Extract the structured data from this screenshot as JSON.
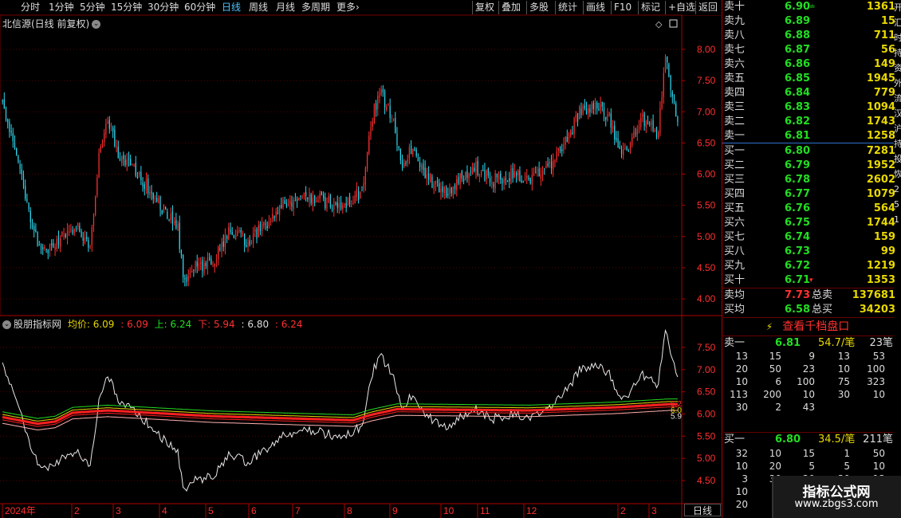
{
  "toolbar": {
    "periods": [
      "分时",
      "1分钟",
      "5分钟",
      "15分钟",
      "30分钟",
      "60分钟",
      "日线",
      "周线",
      "月线",
      "多周期",
      "更多"
    ],
    "active_period": "日线",
    "more_suffix": "›",
    "buttons": [
      "复权",
      "叠加",
      "多股",
      "统计",
      "画线",
      "F10",
      "标记",
      "+自选",
      "返回"
    ]
  },
  "main_chart": {
    "title": "北信源(日线 前复权)",
    "y_ticks": [
      "8.00",
      "7.50",
      "7.00",
      "6.50",
      "6.00",
      "5.50",
      "5.00",
      "4.50",
      "4.00"
    ],
    "y_values": [
      8.0,
      7.5,
      7.0,
      6.5,
      6.0,
      5.5,
      5.0,
      4.5,
      4.0
    ]
  },
  "indicator": {
    "name": "股朋指标网",
    "avg_label": "均价:",
    "avg_value": "6.09",
    "v2": ": 6.09",
    "up_label": "上:",
    "up_value": "6.24",
    "down_label": "下:",
    "down_value": "5.94",
    "v5": ": 6.80",
    "v6": ": 6.24",
    "y_ticks": [
      "7.50",
      "7.00",
      "6.50",
      "6.00",
      "5.50",
      "5.00",
      "4.50"
    ],
    "y_values": [
      7.5,
      7.0,
      6.5,
      6.0,
      5.5,
      5.0,
      4.5
    ],
    "right_values": [
      "6.2",
      "6.0",
      "5.9"
    ]
  },
  "x_axis": {
    "labels": [
      "2024年",
      "2",
      "3",
      "4",
      "5",
      "6",
      "7",
      "8",
      "9",
      "10",
      "11",
      "12",
      "2",
      "3"
    ],
    "period_label": "日线"
  },
  "order_book": {
    "asks": [
      {
        "label": "卖十",
        "price": "6.90",
        "vol": "1361",
        "arrow": "≐"
      },
      {
        "label": "卖九",
        "price": "6.89",
        "vol": "15"
      },
      {
        "label": "卖八",
        "price": "6.88",
        "vol": "711"
      },
      {
        "label": "卖七",
        "price": "6.87",
        "vol": "56"
      },
      {
        "label": "卖六",
        "price": "6.86",
        "vol": "149"
      },
      {
        "label": "卖五",
        "price": "6.85",
        "vol": "1945"
      },
      {
        "label": "卖四",
        "price": "6.84",
        "vol": "779"
      },
      {
        "label": "卖三",
        "price": "6.83",
        "vol": "1094"
      },
      {
        "label": "卖二",
        "price": "6.82",
        "vol": "1743"
      },
      {
        "label": "卖一",
        "price": "6.81",
        "vol": "1258"
      }
    ],
    "bids": [
      {
        "label": "买一",
        "price": "6.80",
        "vol": "7281"
      },
      {
        "label": "买二",
        "price": "6.79",
        "vol": "1952"
      },
      {
        "label": "买三",
        "price": "6.78",
        "vol": "2602"
      },
      {
        "label": "买四",
        "price": "6.77",
        "vol": "1079"
      },
      {
        "label": "买五",
        "price": "6.76",
        "vol": "564"
      },
      {
        "label": "买六",
        "price": "6.75",
        "vol": "1744"
      },
      {
        "label": "买七",
        "price": "6.74",
        "vol": "159"
      },
      {
        "label": "买八",
        "price": "6.73",
        "vol": "99"
      },
      {
        "label": "买九",
        "price": "6.72",
        "vol": "1219"
      },
      {
        "label": "买十",
        "price": "6.71",
        "vol": "1353",
        "arrow": "▾"
      }
    ],
    "ask_avg": {
      "label": "卖均",
      "price": "7.73",
      "total_label": "总卖",
      "total": "137681"
    },
    "bid_avg": {
      "label": "买均",
      "price": "6.58",
      "total_label": "总买",
      "total": "34203"
    }
  },
  "level2": {
    "button": "查看千档盘口",
    "sell1": {
      "label": "卖一",
      "price": "6.81",
      "per": "54.7/笔",
      "count": "23笔"
    },
    "sell_grid": [
      [
        "13",
        "15",
        "9",
        "13",
        "53"
      ],
      [
        "20",
        "50",
        "23",
        "10",
        "100"
      ],
      [
        "10",
        "6",
        "100",
        "75",
        "323"
      ],
      [
        "113",
        "200",
        "10",
        "30",
        "10"
      ],
      [
        "30",
        "2",
        "43",
        "",
        ""
      ]
    ],
    "buy1": {
      "label": "买一",
      "price": "6.80",
      "per": "34.5/笔",
      "count": "211笔"
    },
    "buy_grid": [
      [
        "32",
        "10",
        "15",
        "1",
        "50"
      ],
      [
        "10",
        "20",
        "5",
        "5",
        "10"
      ],
      [
        "3",
        "30",
        "20",
        "30",
        "13"
      ],
      [
        "10",
        "",
        "",
        "",
        ""
      ],
      [
        "20",
        "",
        "",
        "",
        ""
      ]
    ]
  },
  "side_text": [
    "开",
    "汇",
    "时",
    "持",
    "资",
    "外",
    "流",
    "汉",
    "沪",
    "持",
    "投",
    "恢",
    "2",
    "5",
    "1"
  ],
  "watermark": {
    "line1": "指标公式网",
    "line2": "www.zbgs3.com"
  },
  "colors": {
    "up": "#ff3030",
    "down": "#2fd9ef",
    "green": "#22dd22",
    "yellow": "#e8d800",
    "grid": "#5a0000",
    "accent": "#4fc3ff"
  }
}
